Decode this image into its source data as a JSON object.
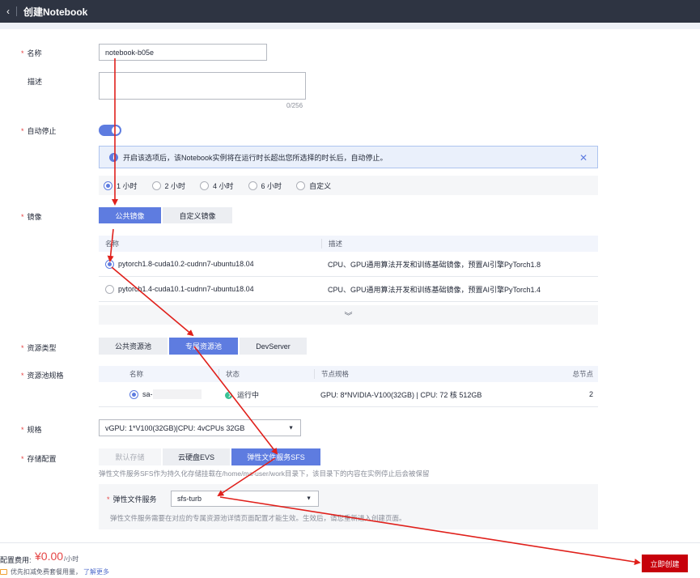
{
  "header": {
    "back_icon": "chevron-left-icon",
    "title": "创建Notebook"
  },
  "form": {
    "name": {
      "label": "名称",
      "value": "notebook-b05e"
    },
    "description": {
      "label": "描述",
      "counter": "0/256"
    },
    "auto_stop": {
      "label": "自动停止",
      "enabled": true,
      "info": "开启该选项后，该Notebook实例将在运行时长超出您所选择的时长后，自动停止。",
      "options": [
        "1 小时",
        "2 小时",
        "4 小时",
        "6 小时",
        "自定义"
      ],
      "selected": "1 小时"
    },
    "image": {
      "label": "镜像",
      "tabs": [
        "公共镜像",
        "自定义镜像"
      ],
      "active_tab": "公共镜像",
      "columns": [
        "名称",
        "描述"
      ],
      "rows": [
        {
          "name": "pytorch1.8-cuda10.2-cudnn7-ubuntu18.04",
          "desc": "CPU、GPU通用算法开发和训练基础镜像，预置AI引擎PyTorch1.8",
          "selected": true
        },
        {
          "name": "pytorch1.4-cuda10.1-cudnn7-ubuntu18.04",
          "desc": "CPU、GPU通用算法开发和训练基础镜像，预置AI引擎PyTorch1.4",
          "selected": false
        }
      ],
      "expand_icon": "double-chevron-down-icon"
    },
    "resource_type": {
      "label": "资源类型",
      "options": [
        "公共资源池",
        "专属资源池",
        "DevServer"
      ],
      "active": "专属资源池"
    },
    "pool_spec": {
      "label": "资源池规格",
      "columns": [
        "名称",
        "状态",
        "节点规格",
        "总节点"
      ],
      "row": {
        "name": "sa-",
        "status": "运行中",
        "node_spec": "GPU: 8*NVIDIA-V100(32GB) | CPU: 72 核 512GB",
        "total_nodes": "2"
      }
    },
    "flavor": {
      "label": "规格",
      "value": "vGPU: 1*V100(32GB)|CPU: 4vCPUs 32GB"
    },
    "storage": {
      "label": "存储配置",
      "options": [
        "默认存储",
        "云硬盘EVS",
        "弹性文件服务SFS"
      ],
      "active": "弹性文件服务SFS",
      "hint": "弹性文件服务SFS作为持久化存储挂载在/home/ma-user/work目录下，该目录下的内容在实例停止后会被保留",
      "sfs_label": "弹性文件服务",
      "sfs_value": "sfs-turb",
      "sfs_hint": "弹性文件服务需要在对应的专属资源池详情页面配置才能生效。生效后，请您重新进入创建页面。"
    }
  },
  "footer": {
    "price_label": "配置费用:",
    "price": "¥0.00",
    "price_unit": "/小时",
    "discount_text": "优先扣减免费套餐用量，",
    "learn_more": "了解更多",
    "create_button": "立即创建"
  },
  "colors": {
    "primary": "#5e7ce0",
    "danger": "#c7000b",
    "arrow": "#e0201b",
    "header_bg": "#2e3442"
  }
}
